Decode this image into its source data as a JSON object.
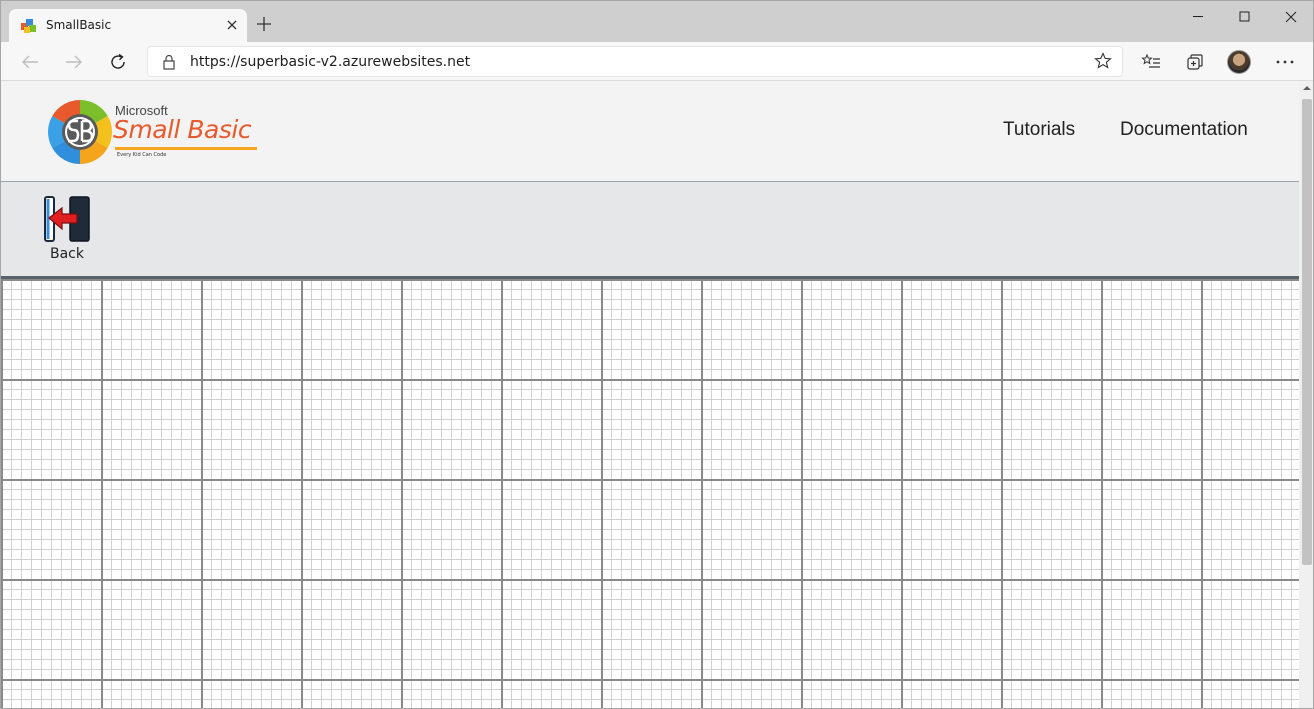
{
  "browser": {
    "tab_title": "SmallBasic",
    "url": "https://superbasic-v2.azurewebsites.net",
    "icons": {
      "favicon": "smallbasic-favicon-icon",
      "close": "close-icon",
      "new_tab": "plus-icon",
      "back": "arrow-left-icon",
      "forward": "arrow-right-icon",
      "refresh": "refresh-icon",
      "lock": "lock-icon",
      "favorite": "star-icon",
      "favorites": "favorites-list-icon",
      "collections": "collections-icon",
      "profile": "avatar",
      "menu": "more-icon"
    }
  },
  "site": {
    "logo": {
      "brand_top": "Microsoft",
      "brand_main": "Small Basic",
      "tagline": "Every Kid Can Code"
    },
    "nav": [
      {
        "label": "Tutorials"
      },
      {
        "label": "Documentation"
      }
    ]
  },
  "actions": {
    "back_label": "Back"
  },
  "colors": {
    "accent_orange": "#e8592b",
    "accent_yellow": "#f4a51c",
    "back_arrow_red": "#e02020"
  }
}
